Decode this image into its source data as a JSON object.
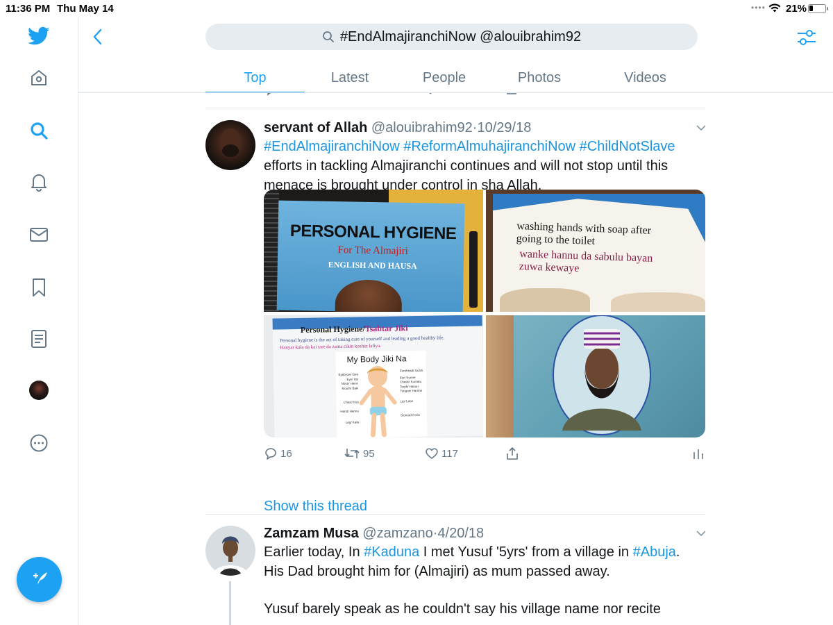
{
  "status_bar": {
    "time": "11:36 PM",
    "date": "Thu May 14",
    "signal_dots": "••••",
    "battery_text": "21%",
    "battery_level": 0.21
  },
  "sidebar": {
    "items": [
      {
        "icon": "twitter-logo-icon"
      },
      {
        "icon": "home-icon"
      },
      {
        "icon": "explore-search-icon",
        "active": true
      },
      {
        "icon": "notifications-bell-icon"
      },
      {
        "icon": "messages-envelope-icon"
      },
      {
        "icon": "bookmarks-icon"
      },
      {
        "icon": "lists-icon"
      },
      {
        "icon": "profile-avatar"
      },
      {
        "icon": "more-icon"
      }
    ],
    "compose_icon": "compose-tweet-icon"
  },
  "header": {
    "search_query": "#EndAlmajiranchiNow @alouibrahim92",
    "tabs": [
      {
        "label": "Top",
        "active": true
      },
      {
        "label": "Latest"
      },
      {
        "label": "People"
      },
      {
        "label": "Photos"
      },
      {
        "label": "Videos"
      }
    ]
  },
  "colors": {
    "accent": "#1da1f2",
    "link": "#1b95e0",
    "text": "#14171a",
    "secondary_text": "#657786",
    "divider": "#e1e8ed"
  },
  "tweets": [
    {
      "name": "servant of Allah",
      "handle": "@alouibrahim92",
      "separator": "·",
      "date": "10/29/18",
      "hashtags": [
        "#EndAlmajiranchiNow",
        "#ReformAlmuhajiranchiNow",
        "#ChildNotSlave"
      ],
      "text": "efforts in tackling Almajiranchi continues and will not stop until this menace is brought under control in sha Allah.",
      "media": {
        "image1": {
          "title": "PERSONAL HYGIENE",
          "subtitle": "For The Almajiri",
          "line3": "ENGLISH AND HAUSA"
        },
        "image2": {
          "english": "washing hands with soap after going to the toilet",
          "hausa": "wanke hannu da sabulu bayan zuwa kewaye"
        },
        "image3": {
          "heading_a": "Personal Hygiene/",
          "heading_b": "Tsabtar Jiki",
          "body_english": "Personal hygiene is the act of taking care of yourself and leading a good healthy life.",
          "body_hausa": "Hanyar kula da kai tare da zama cikin koshin lafiya.",
          "diagram_title": "My Body Jiki Na",
          "labels_left": [
            "Eyebrow/ Gira",
            "Eye/ Ido",
            "Nose/ Hanci",
            "Mouth/ Baki",
            "Chest/ Kirji",
            "Hand/ Hannu",
            "Leg/ Kafa"
          ],
          "labels_right": [
            "Forehead/ Goshi",
            "Ear/ Kunne",
            "Cheek/ Kumatu",
            "Tooth/ Hakori",
            "Tongue/ Harshe",
            "Lip/ Lebe",
            "Stomach/ Ciki"
          ]
        },
        "image4": {}
      },
      "replies": "16",
      "retweets": "95",
      "likes": "117",
      "show_thread": "Show this thread"
    },
    {
      "name": "Zamzam Musa",
      "handle": "@zamzano",
      "separator": "·",
      "date": "4/20/18",
      "para1_a": "Earlier today, In ",
      "tag1": "#Kaduna",
      "para1_b": " I met Yusuf '5yrs' from a village in ",
      "tag2": "#Abuja",
      "para1_c": ". His Dad brought him for (Almajiri) as mum passed away.",
      "para2": "Yusuf barely speak as he couldn't say his village name nor recite"
    }
  ]
}
